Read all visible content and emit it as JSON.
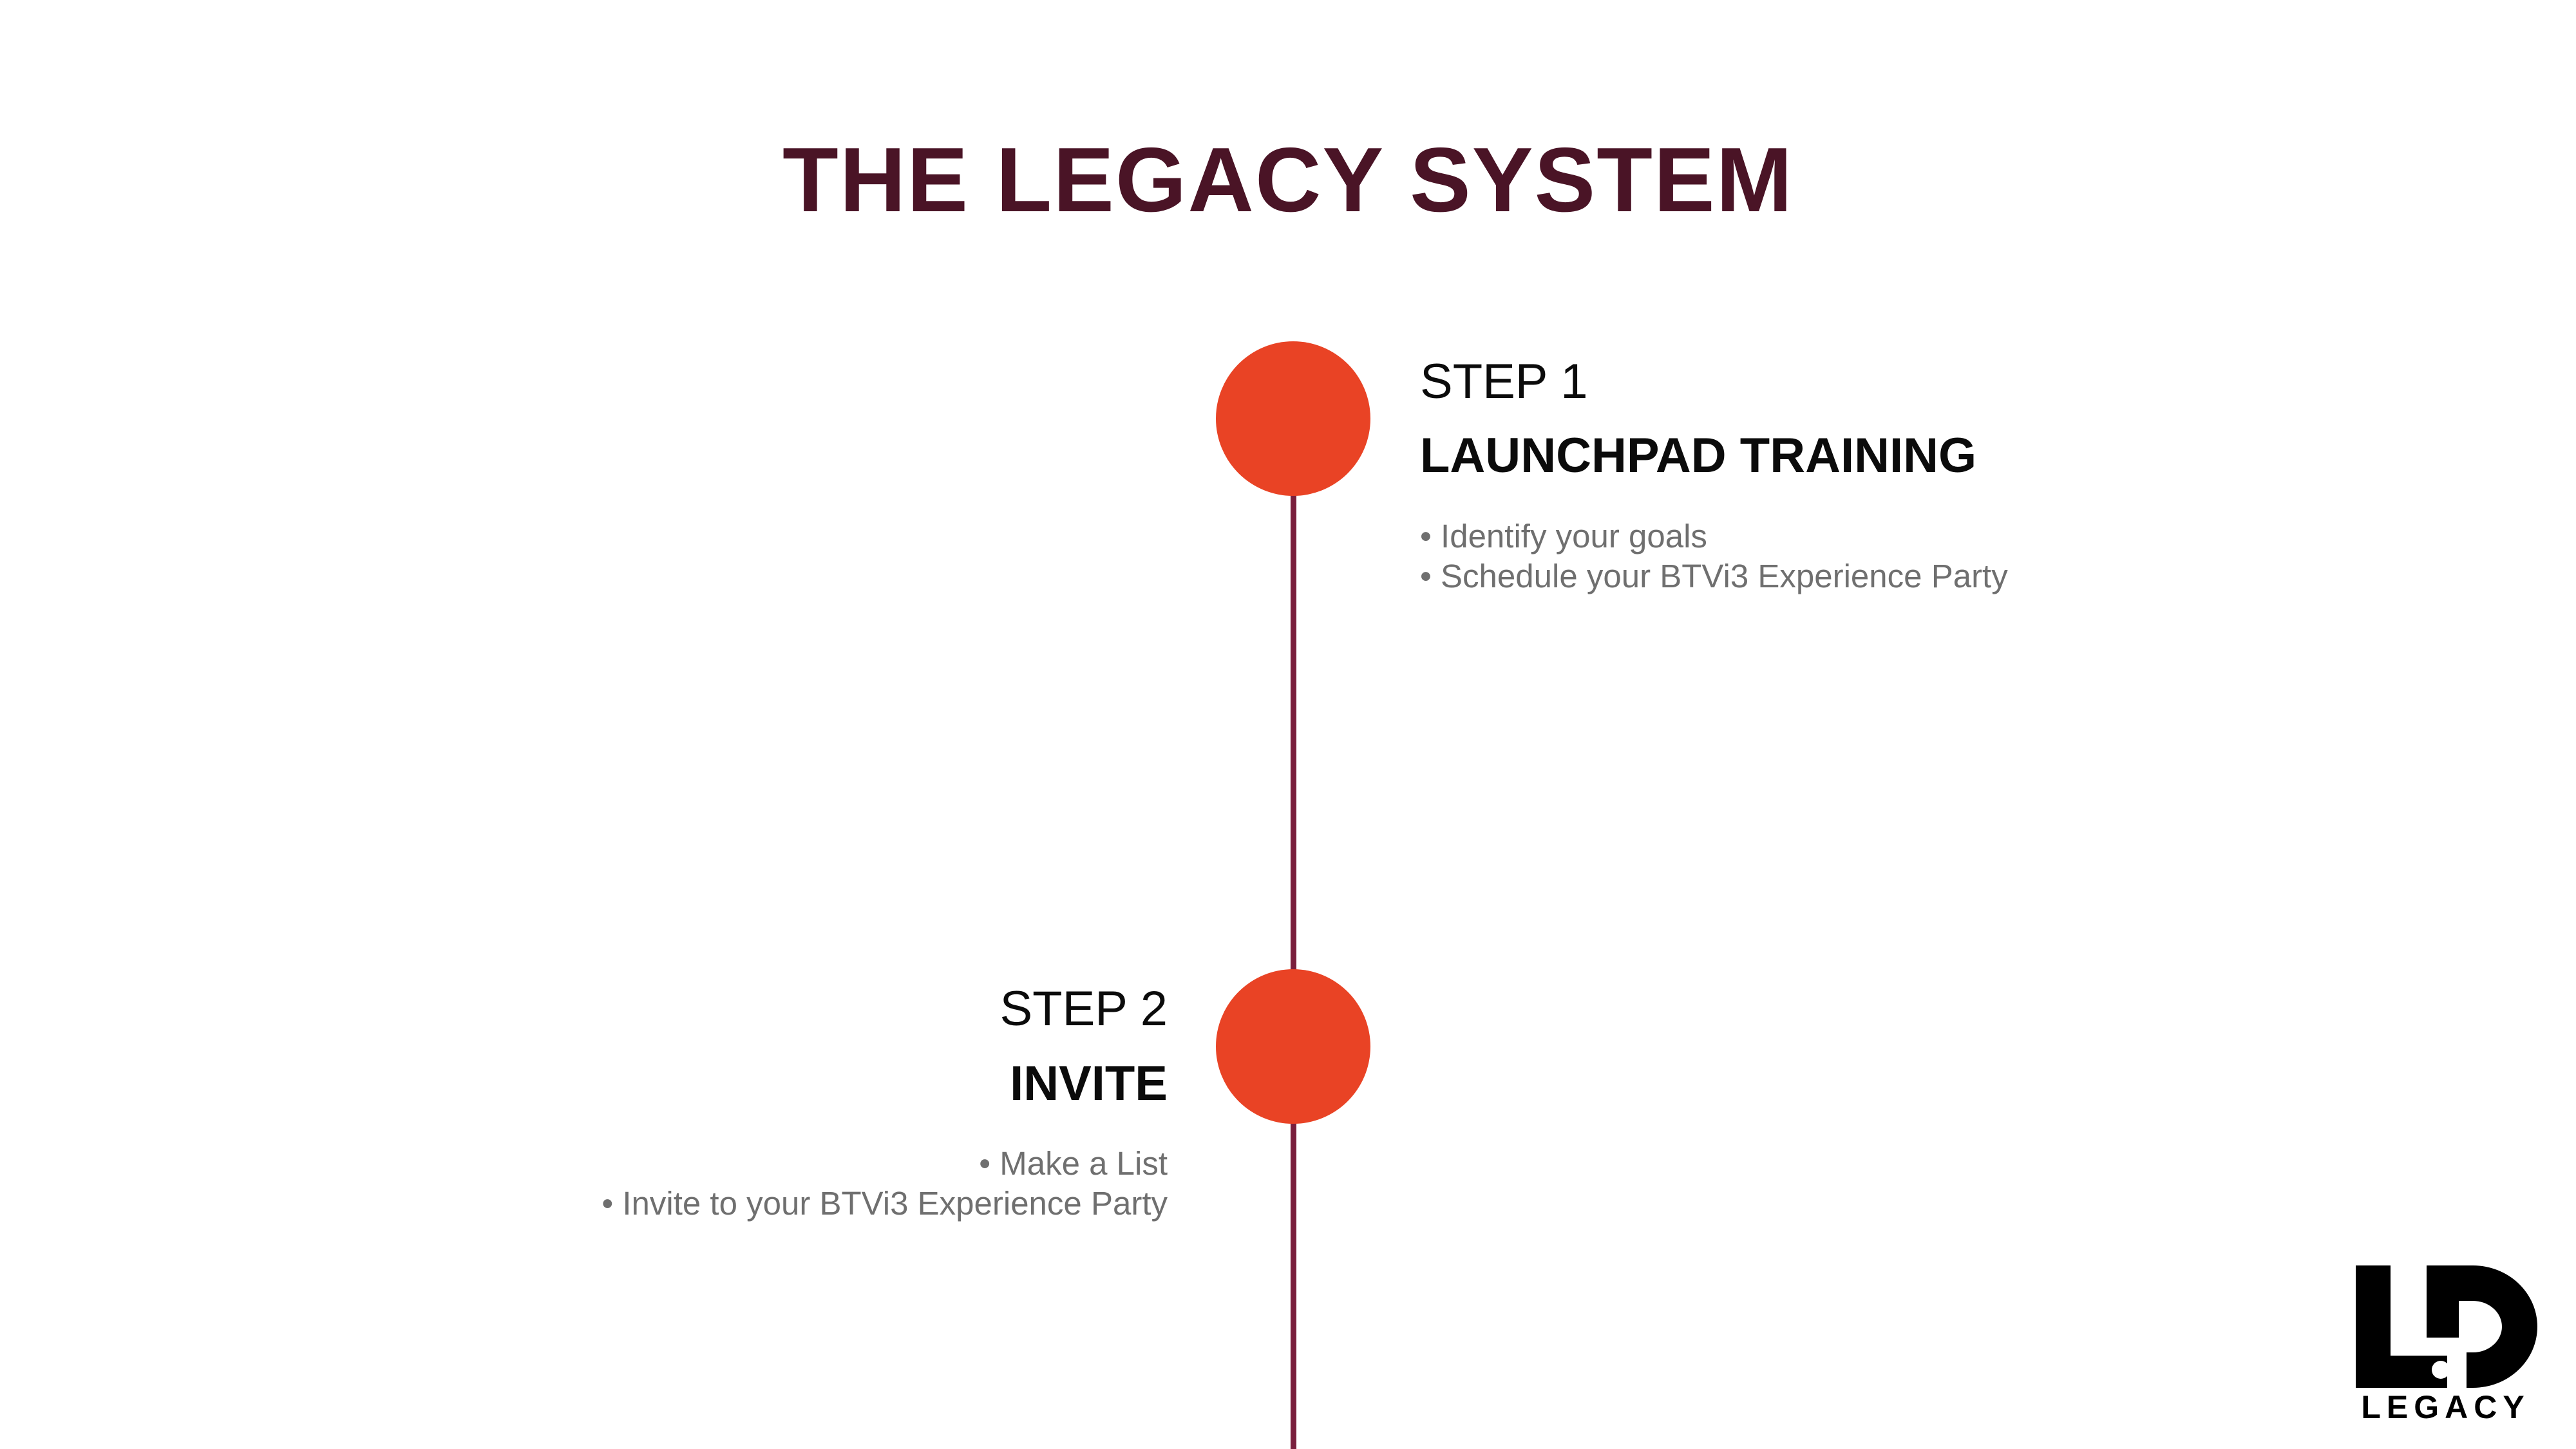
{
  "slide": {
    "title": "THE LEGACY SYSTEM"
  },
  "colors": {
    "title": "#4a1426",
    "timeline_line": "#7a1f3d",
    "dot": "#e94325",
    "step_text": "#0b0b0b",
    "bullet_text": "#6f6f6f",
    "logo": "#000000"
  },
  "steps": [
    {
      "label": "STEP 1",
      "heading": "LAUNCHPAD TRAINING",
      "bullets": [
        "Identify your goals",
        "Schedule your BTVi3 Experience Party"
      ]
    },
    {
      "label": "STEP 2",
      "heading": "INVITE",
      "bullets": [
        "Make a List",
        "Invite to your BTVi3 Experience Party"
      ]
    }
  ],
  "logo": {
    "icon": "ld-legacy-logo-icon",
    "wordmark": "LEGACY"
  }
}
